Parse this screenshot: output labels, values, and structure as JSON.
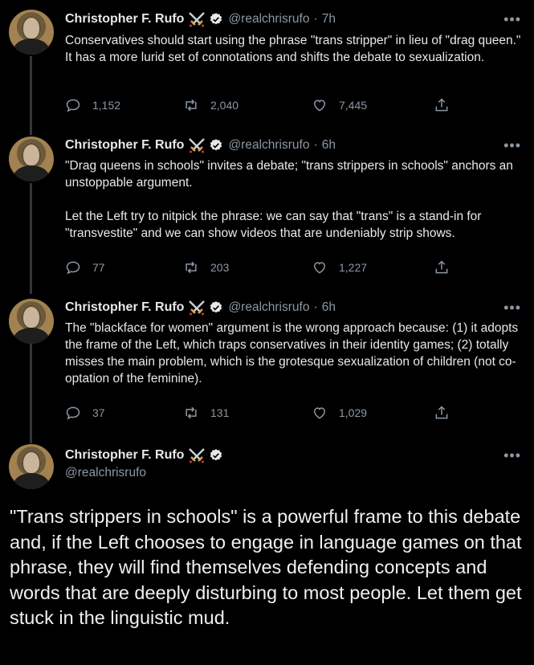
{
  "author": {
    "name": "Christopher F. Rufo",
    "handle": "@realchrisrufo"
  },
  "more_icon": "•••",
  "tweets": [
    {
      "time": "7h",
      "text": "Conservatives should start using the phrase \"trans stripper\" in lieu of \"drag queen.\" It has a more lurid set of connotations and shifts the debate to sexualization.",
      "replies": "1,152",
      "retweets": "2,040",
      "likes": "7,445"
    },
    {
      "time": "6h",
      "text": "\"Drag queens in schools\" invites a debate; \"trans strippers in schools\" anchors an unstoppable argument.\n\nLet the Left try to nitpick the phrase: we can say that \"trans\" is a stand-in for \"transvestite\" and we can show videos that are undeniably strip shows.",
      "replies": "77",
      "retweets": "203",
      "likes": "1,227"
    },
    {
      "time": "6h",
      "text": "The \"blackface for women\" argument is the wrong approach because: (1) it adopts the frame of the Left, which traps conservatives in their identity games; (2) totally misses the main problem, which is the grotesque sexualization of children (not co-optation of the feminine).",
      "replies": "37",
      "retweets": "131",
      "likes": "1,029"
    }
  ],
  "final_tweet": {
    "text": "\"Trans strippers in schools\" is a powerful frame to this debate and, if the Left chooses to engage in language games on that phrase, they will find themselves defending concepts and words that are deeply disturbing to most people. Let them get stuck in the linguistic mud."
  },
  "colors": {
    "background": "#000000",
    "text": "#e7e9ea",
    "muted": "#8b98a5",
    "thread_line": "#333639"
  }
}
